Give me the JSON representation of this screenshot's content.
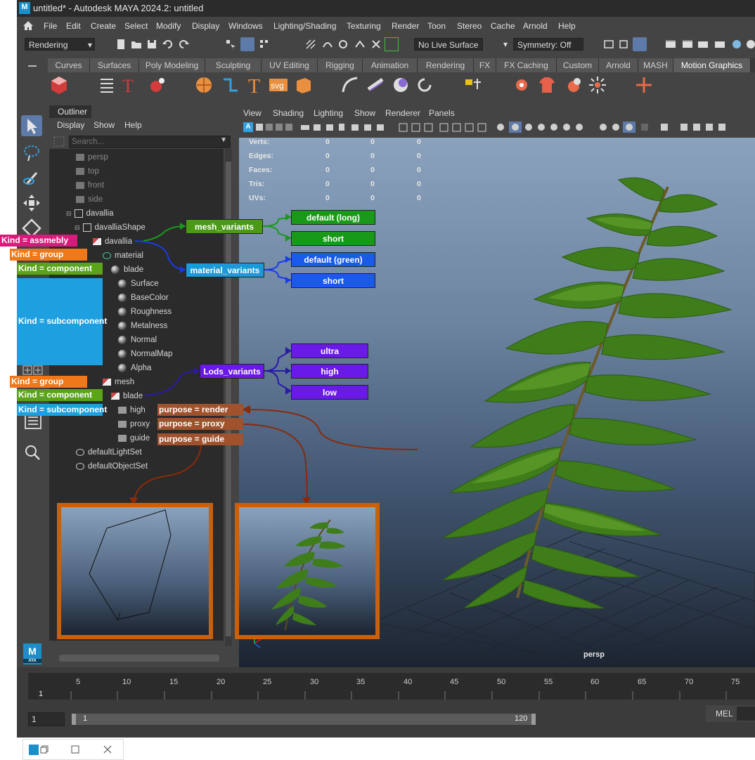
{
  "window": {
    "title": "untitled* - Autodesk MAYA 2024.2: untitled",
    "logo": "M"
  },
  "menubar": [
    "File",
    "Edit",
    "Create",
    "Select",
    "Modify",
    "Display",
    "Windows",
    "Lighting/Shading",
    "Texturing",
    "Render",
    "Toon",
    "Stereo",
    "Cache",
    "Arnold",
    "Help"
  ],
  "statusline": {
    "menuset": "Rendering",
    "live_surface": "No Live Surface",
    "symmetry": "Symmetry: Off"
  },
  "shelf_tabs": [
    "Curves",
    "Surfaces",
    "Poly Modeling",
    "Sculpting",
    "UV Editing",
    "Rigging",
    "Animation",
    "Rendering",
    "FX",
    "FX Caching",
    "Custom",
    "Arnold",
    "MASH",
    "Motion Graphics"
  ],
  "shelf_active": "Motion Graphics",
  "outliner": {
    "title": "Outliner",
    "menu": [
      "Display",
      "Show",
      "Help"
    ],
    "search_placeholder": "Search...",
    "nodes": {
      "persp": "persp",
      "top": "top",
      "front": "front",
      "side": "side",
      "davallia": "davallia",
      "davalliaShape": "davalliaShape",
      "davallia2": "davallia",
      "material": "material",
      "blade": "blade",
      "subs": [
        "Surface",
        "BaseColor",
        "Roughness",
        "Metalness",
        "Normal",
        "NormalMap",
        "Alpha"
      ],
      "mesh": "mesh",
      "blade2": "blade",
      "high": "high",
      "proxy": "proxy",
      "guide": "guide",
      "defaultLightSet": "defaultLightSet",
      "defaultObjectSet": "defaultObjectSet"
    }
  },
  "viewport": {
    "menu": [
      "View",
      "Shading",
      "Lighting",
      "Show",
      "Renderer",
      "Panels"
    ],
    "hud": [
      {
        "label": "Verts:",
        "v": [
          "0",
          "0",
          "0"
        ]
      },
      {
        "label": "Edges:",
        "v": [
          "0",
          "0",
          "0"
        ]
      },
      {
        "label": "Faces:",
        "v": [
          "0",
          "0",
          "0"
        ]
      },
      {
        "label": "Tris:",
        "v": [
          "0",
          "0",
          "0"
        ]
      },
      {
        "label": "UVs:",
        "v": [
          "0",
          "0",
          "0"
        ]
      }
    ],
    "camera": "persp"
  },
  "annotations": {
    "kind_assembly": "Kind = assmebly",
    "kind_group": "Kind = group",
    "kind_component": "Kind = component",
    "kind_subcomponent": "Kind = subcomponent",
    "kind_group2": "Kind = group",
    "kind_component2": "Kind = component",
    "kind_subcomponent2": "Kind = subcomponent",
    "purpose_render": "purpose = render",
    "purpose_proxy": "purpose = proxy",
    "purpose_guide": "purpose = guide",
    "mesh_variants": "mesh_variants",
    "mesh_variant_options": [
      "default (long)",
      "short"
    ],
    "material_variants": "material_variants",
    "material_variant_options": [
      "default (green)",
      "short"
    ],
    "lods_variants": "Lods_variants",
    "lods_variant_options": [
      "ultra",
      "high",
      "low"
    ]
  },
  "colors": {
    "assembly": "#d81b7a",
    "group": "#f07818",
    "component": "#5aa41a",
    "subcomponent": "#1ea0e0",
    "purpose": "#a0522d",
    "mesh_var": "#189a18",
    "mat_var": "#1a5ae8",
    "lod_var": "#6a1ae8",
    "thumb_border": "#c8600c"
  },
  "timeline": {
    "ticks": [
      "5",
      "10",
      "15",
      "20",
      "25",
      "30",
      "35",
      "40",
      "45",
      "50",
      "55",
      "60",
      "65",
      "70",
      "75"
    ],
    "current_frame": "1"
  },
  "range": {
    "start": "1",
    "range_start": "1",
    "range_end": "120"
  },
  "cmdline": {
    "label": "MEL"
  }
}
